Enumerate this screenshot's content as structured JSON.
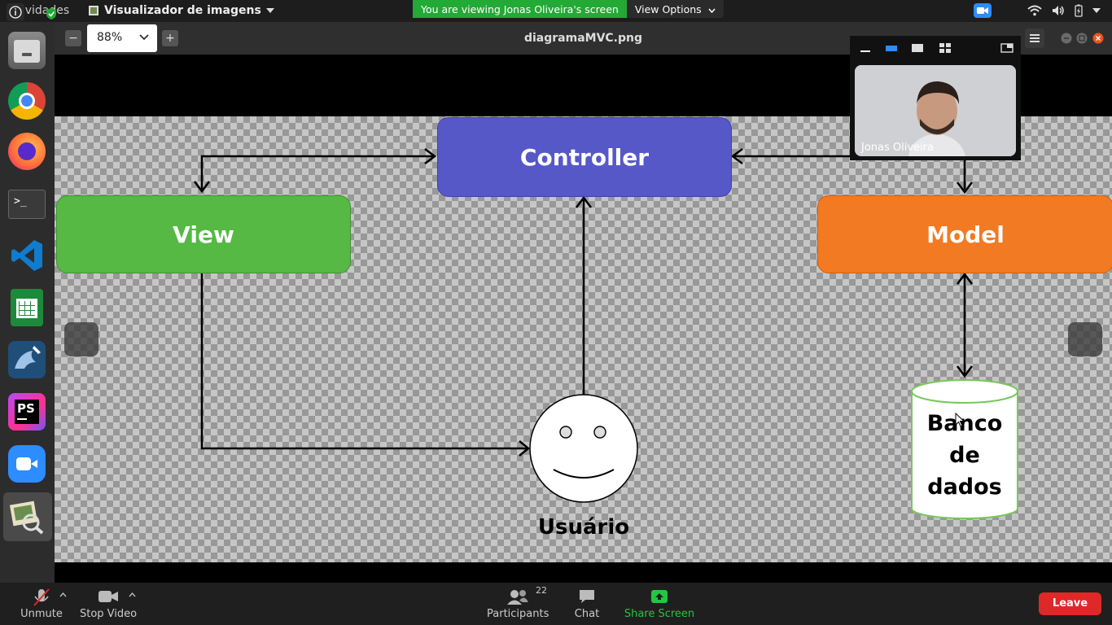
{
  "topbar": {
    "activities": "Atividades",
    "app_name": "Visualizador de imagens"
  },
  "zoom_banner": {
    "viewing_text": "You are viewing Jonas Oliveira's screen",
    "view_options": "View Options"
  },
  "viewer": {
    "zoom_value": "88%",
    "file_title": "diagramaMVC.png"
  },
  "diagram": {
    "controller": "Controller",
    "view": "View",
    "model": "Model",
    "database_lines": [
      "Banco",
      "de",
      "dados"
    ],
    "user": "Usuário",
    "colors": {
      "controller": "#5658c8",
      "view": "#55b944",
      "model": "#f27a22",
      "database_border": "#7ac75a"
    }
  },
  "video_panel": {
    "participant_name": "Jonas Oliveira"
  },
  "bottombar": {
    "unmute": "Unmute",
    "stop_video": "Stop Video",
    "participants": "Participants",
    "participants_count": "22",
    "chat": "Chat",
    "share_screen": "Share Screen",
    "leave": "Leave"
  },
  "dock_icons": [
    "files-icon",
    "chrome-icon",
    "firefox-icon",
    "terminal-icon",
    "vscode-icon",
    "spreadsheet-icon",
    "mysql-workbench-icon",
    "phpstorm-icon",
    "zoom-icon",
    "image-viewer-icon"
  ]
}
